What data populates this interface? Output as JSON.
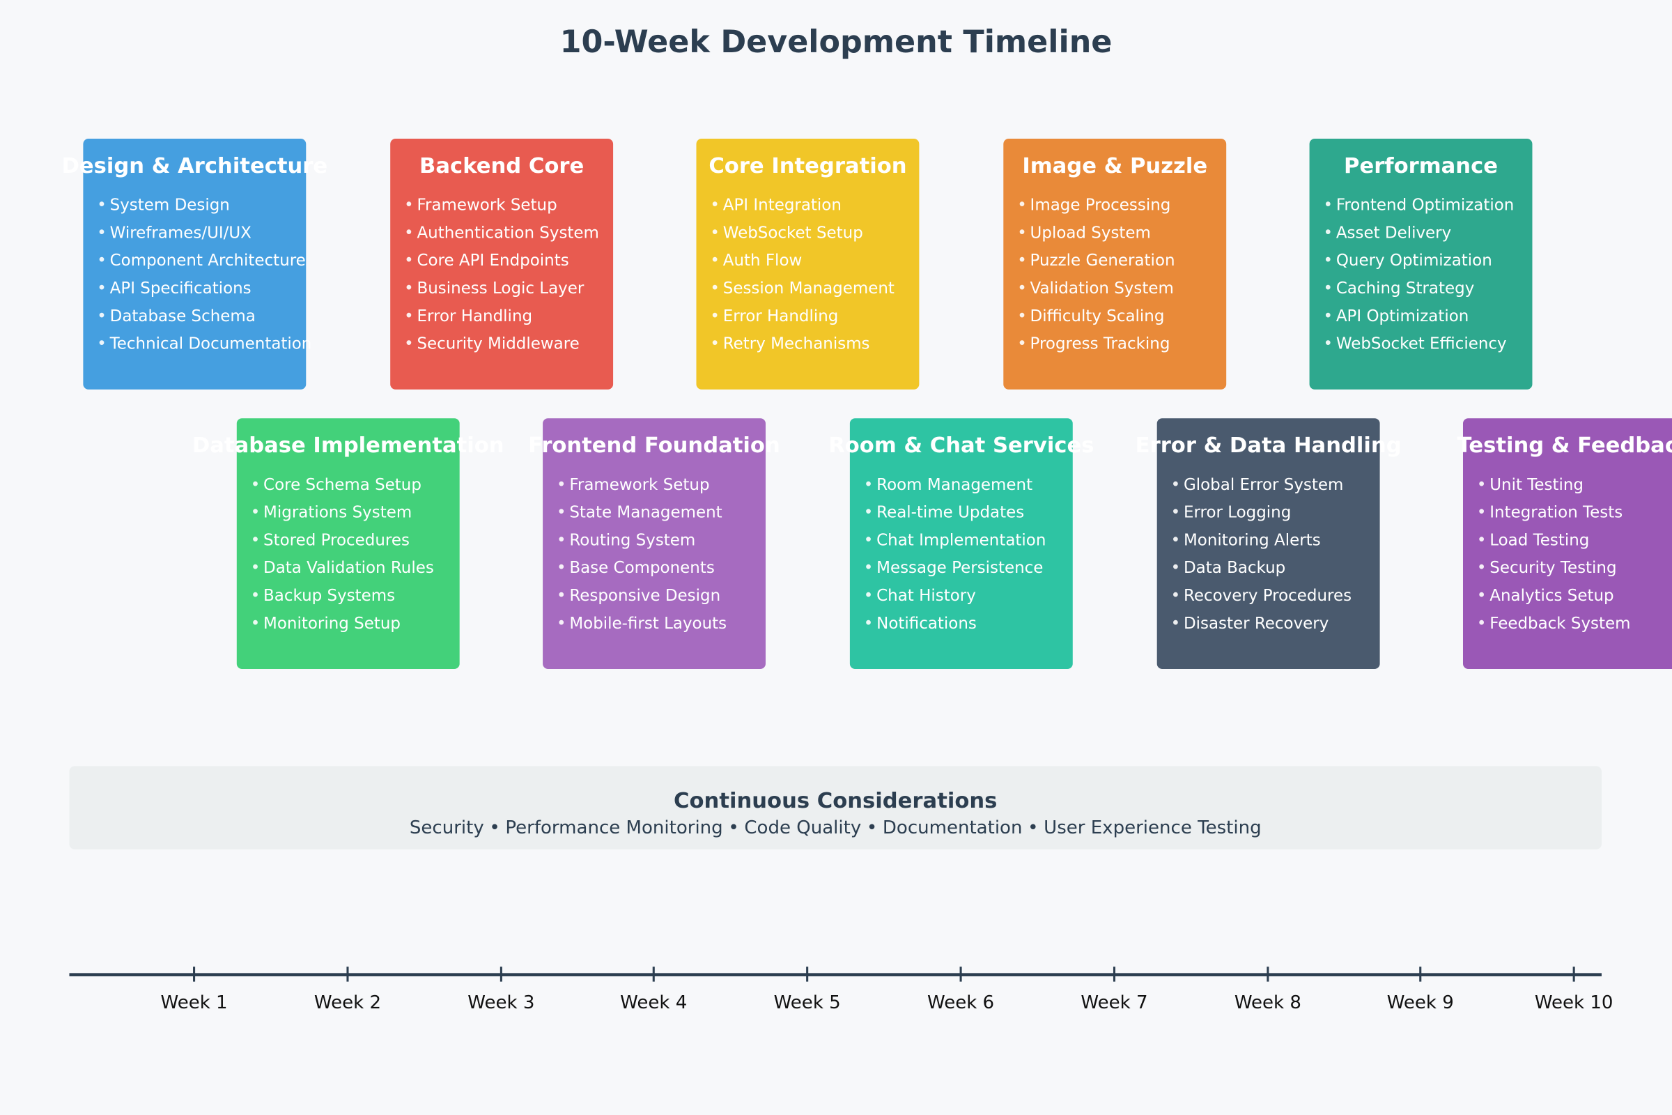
{
  "title": "10-Week Development Timeline",
  "phases": [
    {
      "title": "Design & Architecture",
      "color": "#459fe0",
      "items": [
        "System Design",
        "Wireframes/UI/UX",
        "Component Architecture",
        "API Specifications",
        "Database Schema",
        "Technical Documentation"
      ]
    },
    {
      "title": "Database Implementation",
      "color": "#43d17a",
      "items": [
        "Core Schema Setup",
        "Migrations System",
        "Stored Procedures",
        "Data Validation Rules",
        "Backup Systems",
        "Monitoring Setup"
      ]
    },
    {
      "title": "Backend Core",
      "color": "#e85b50",
      "items": [
        "Framework Setup",
        "Authentication System",
        "Core API Endpoints",
        "Business Logic Layer",
        "Error Handling",
        "Security Middleware"
      ]
    },
    {
      "title": "Frontend Foundation",
      "color": "#a66bc0",
      "items": [
        "Framework Setup",
        "State Management",
        "Routing System",
        "Base Components",
        "Responsive Design",
        "Mobile-first Layouts"
      ]
    },
    {
      "title": "Core Integration",
      "color": "#f1c628",
      "items": [
        "API Integration",
        "WebSocket Setup",
        "Auth Flow",
        "Session Management",
        "Error Handling",
        "Retry Mechanisms"
      ]
    },
    {
      "title": "Room & Chat Services",
      "color": "#2ec4a3",
      "items": [
        "Room Management",
        "Real-time Updates",
        "Chat Implementation",
        "Message Persistence",
        "Chat History",
        "Notifications"
      ]
    },
    {
      "title": "Image & Puzzle",
      "color": "#e98a39",
      "items": [
        "Image Processing",
        "Upload System",
        "Puzzle Generation",
        "Validation System",
        "Difficulty Scaling",
        "Progress Tracking"
      ]
    },
    {
      "title": "Error & Data Handling",
      "color": "#4a5a6e",
      "items": [
        "Global Error System",
        "Error Logging",
        "Monitoring Alerts",
        "Data Backup",
        "Recovery Procedures",
        "Disaster Recovery"
      ]
    },
    {
      "title": "Performance",
      "color": "#2ea88e",
      "items": [
        "Frontend Optimization",
        "Asset Delivery",
        "Query Optimization",
        "Caching Strategy",
        "API Optimization",
        "WebSocket Efficiency"
      ]
    },
    {
      "title": "Testing & Feedback",
      "color": "#9a58b6",
      "items": [
        "Unit Testing",
        "Integration Tests",
        "Load Testing",
        "Security Testing",
        "Analytics Setup",
        "Feedback System"
      ]
    }
  ],
  "considerations": {
    "title": "Continuous Considerations",
    "items": [
      "Security",
      "Performance Monitoring",
      "Code Quality",
      "Documentation",
      "User Experience Testing"
    ]
  },
  "bullet": "•",
  "weeks": [
    "Week 1",
    "Week 2",
    "Week 3",
    "Week 4",
    "Week 5",
    "Week 6",
    "Week 7",
    "Week 8",
    "Week 9",
    "Week 10"
  ]
}
